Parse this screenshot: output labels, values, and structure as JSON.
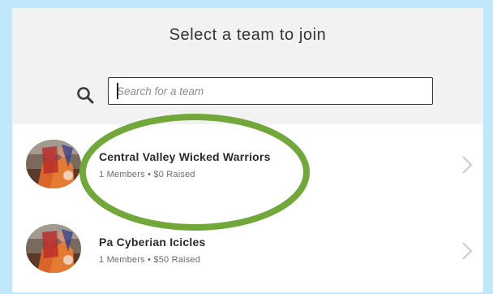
{
  "header": {
    "title": "Select a team to join"
  },
  "search": {
    "placeholder": "Search for a team",
    "icon": "search-icon"
  },
  "teams": [
    {
      "name": "Central Valley Wicked Warriors",
      "meta": "1 Members • $0 Raised",
      "icon": "chevron-right-icon"
    },
    {
      "name": "Pa Cyberian Icicles",
      "meta": "1 Members • $50 Raised",
      "icon": "chevron-right-icon"
    }
  ],
  "colors": {
    "background": "#bfe9fb",
    "header_bg": "#f2f2f2",
    "highlight": "#72a73a"
  }
}
